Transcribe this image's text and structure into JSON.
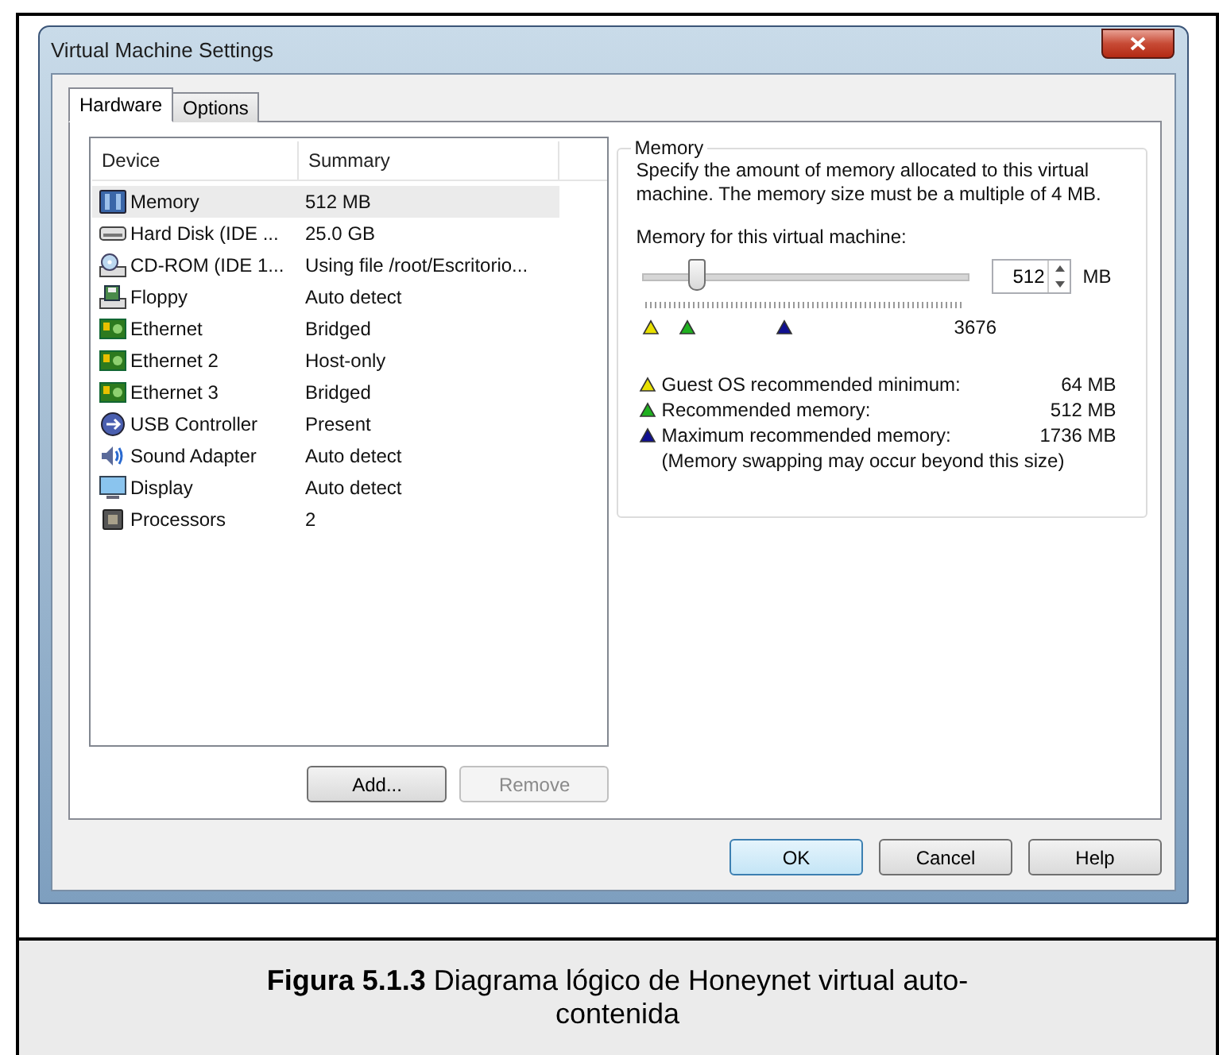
{
  "window": {
    "title": "Virtual Machine Settings"
  },
  "tabs": [
    {
      "label": "Hardware",
      "selected": true
    },
    {
      "label": "Options",
      "selected": false
    }
  ],
  "device_list": {
    "columns": [
      "Device",
      "Summary"
    ],
    "rows": [
      {
        "kind": "memory",
        "device": "Memory",
        "summary": "512 MB",
        "selected": true
      },
      {
        "kind": "disk",
        "device": "Hard Disk (IDE ...",
        "summary": "25.0 GB",
        "selected": false
      },
      {
        "kind": "cdrom",
        "device": "CD-ROM (IDE 1...",
        "summary": "Using file /root/Escritorio...",
        "selected": false
      },
      {
        "kind": "floppy",
        "device": "Floppy",
        "summary": "Auto detect",
        "selected": false
      },
      {
        "kind": "network",
        "device": "Ethernet",
        "summary": "Bridged",
        "selected": false
      },
      {
        "kind": "network",
        "device": "Ethernet 2",
        "summary": "Host-only",
        "selected": false
      },
      {
        "kind": "network",
        "device": "Ethernet 3",
        "summary": "Bridged",
        "selected": false
      },
      {
        "kind": "usb",
        "device": "USB Controller",
        "summary": "Present",
        "selected": false
      },
      {
        "kind": "sound",
        "device": "Sound Adapter",
        "summary": "Auto detect",
        "selected": false
      },
      {
        "kind": "display",
        "device": "Display",
        "summary": "Auto detect",
        "selected": false
      },
      {
        "kind": "processor",
        "device": "Processors",
        "summary": "2",
        "selected": false
      }
    ]
  },
  "list_buttons": [
    {
      "label": "Add...",
      "disabled": false
    },
    {
      "label": "Remove",
      "disabled": true
    }
  ],
  "memory_group": {
    "title": "Memory",
    "description": "Specify the amount of memory allocated to this virtual machine. The memory size must be a multiple of 4 MB.",
    "slider_label": "Memory for this virtual machine:",
    "slider": {
      "level": 0.16
    },
    "value": "512",
    "unit": "MB",
    "scale_max": "3676",
    "legend": [
      {
        "color": "#e8e000",
        "label": "Guest OS recommended minimum:",
        "value": "64 MB"
      },
      {
        "color": "#20b020",
        "label": "Recommended memory:",
        "value": "512 MB"
      },
      {
        "color": "#101090",
        "label": "Maximum recommended memory:",
        "value": "1736 MB"
      }
    ],
    "note": "(Memory swapping may occur beyond this size)"
  },
  "dialog_buttons": [
    {
      "label": "OK",
      "default": true
    },
    {
      "label": "Cancel",
      "default": false
    },
    {
      "label": "Help",
      "default": false
    }
  ],
  "caption": "**Figura 5.1.3** Diagrama lógico de Honeynet virtual auto-contenida"
}
